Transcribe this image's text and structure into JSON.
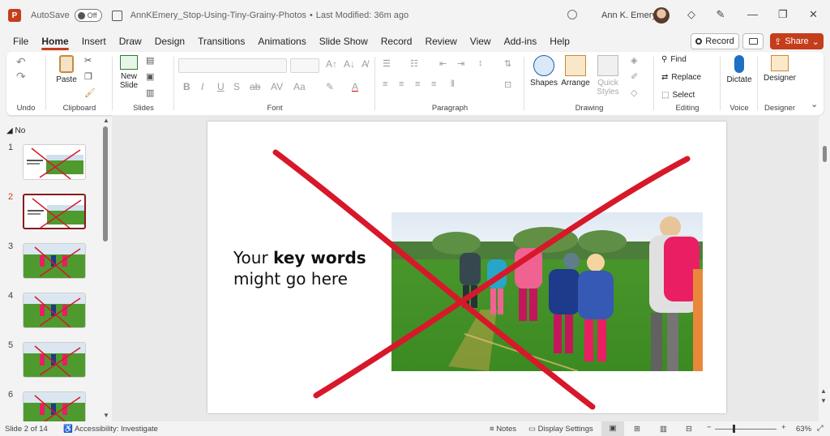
{
  "titlebar": {
    "app_logo": "P",
    "autosave_label": "AutoSave",
    "autosave_state": "Off",
    "doc_title": "AnnKEmery_Stop-Using-Tiny-Grainy-Photos",
    "separator": "•",
    "last_modified": "Last Modified: 36m ago",
    "user_name": "Ann K. Emery"
  },
  "menu": {
    "tabs": [
      "File",
      "Home",
      "Insert",
      "Draw",
      "Design",
      "Transitions",
      "Animations",
      "Slide Show",
      "Record",
      "Review",
      "View",
      "Add-ins",
      "Help"
    ],
    "active": "Home",
    "record_label": "Record",
    "share_label": "Share"
  },
  "ribbon": {
    "undo": {
      "label": "Undo"
    },
    "clipboard": {
      "label": "Clipboard",
      "paste": "Paste"
    },
    "slides": {
      "label": "Slides",
      "new_slide": "New Slide"
    },
    "font": {
      "label": "Font"
    },
    "paragraph": {
      "label": "Paragraph"
    },
    "drawing": {
      "label": "Drawing",
      "shapes": "Shapes",
      "arrange": "Arrange",
      "quick_styles": "Quick Styles"
    },
    "editing": {
      "label": "Editing",
      "find": "Find",
      "replace": "Replace",
      "select": "Select"
    },
    "voice": {
      "label": "Voice",
      "dictate": "Dictate"
    },
    "designer": {
      "label": "Designer",
      "designer_btn": "Designer"
    }
  },
  "slide_pane": {
    "section": "No",
    "numbers": [
      "1",
      "2",
      "3",
      "4",
      "5",
      "6"
    ],
    "active_index": 1
  },
  "slide": {
    "line1_prefix": "Your ",
    "line1_bold": "key words",
    "line2": "might go here"
  },
  "status": {
    "slide_info": "Slide 2 of 14",
    "accessibility": "Accessibility: Investigate",
    "notes": "Notes",
    "display_settings": "Display Settings",
    "zoom": "63%"
  },
  "colors": {
    "accent": "#c43e1c",
    "cross": "#d7182a"
  }
}
